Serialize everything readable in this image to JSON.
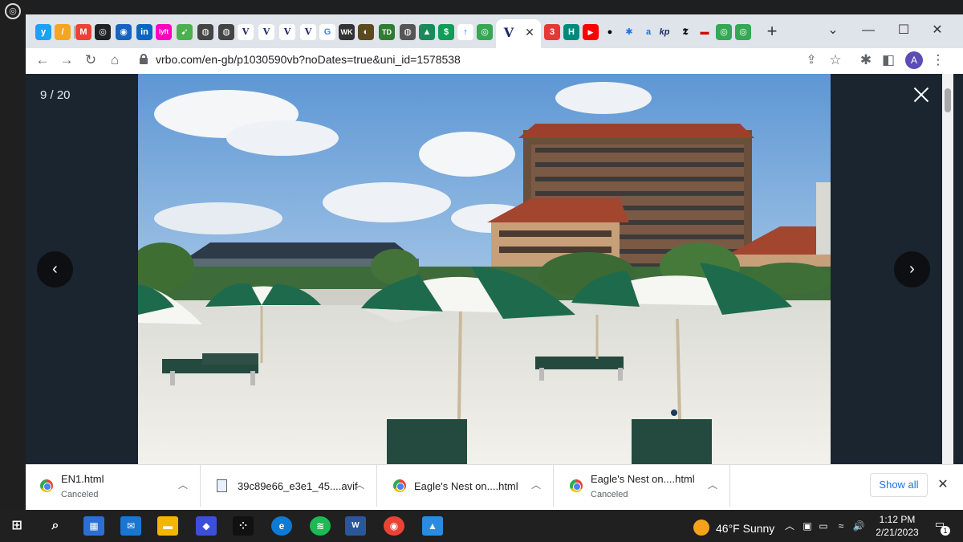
{
  "browser": {
    "url": "vrbo.com/en-gb/p1030590vb?noDates=true&uni_id=1578538",
    "profile_initial": "A",
    "active_tab_glyph": "V",
    "tab_glyphs": [
      "y",
      "/",
      "M",
      "◎",
      "◉",
      "in",
      "lyft",
      "➹",
      "◍",
      "◍",
      "V",
      "V",
      "V",
      "V",
      "G",
      "WK",
      "◐",
      "TD",
      "◍",
      "▲",
      "$",
      "↑",
      "◎"
    ],
    "right_tab_glyphs": [
      "3",
      "H",
      "▶",
      "●",
      "✱",
      "a",
      "kp",
      "𝕿",
      "▬",
      "◎",
      "◎"
    ]
  },
  "viewer": {
    "counter": "9 / 20",
    "prev_glyph": "‹",
    "next_glyph": "›"
  },
  "downloads": {
    "items": [
      {
        "name": "EN1.html",
        "status": "Canceled",
        "icon": "chrome-icon"
      },
      {
        "name": "39c89e66_e3e1_45....avif",
        "status": "",
        "icon": "file-icon"
      },
      {
        "name": "Eagle's Nest on....html",
        "status": "",
        "icon": "chrome-icon"
      },
      {
        "name": "Eagle's Nest on....html",
        "status": "Canceled",
        "icon": "chrome-icon"
      }
    ],
    "show_all": "Show all"
  },
  "taskbar": {
    "weather": "46°F  Sunny",
    "time": "1:12 PM",
    "date": "2/21/2023",
    "notifications": "1"
  },
  "colors": {
    "accent": "#1a73e8",
    "umbrella_green": "#1d6b4c",
    "sky": "#5f9ed8",
    "sand": "#ecebe6"
  }
}
